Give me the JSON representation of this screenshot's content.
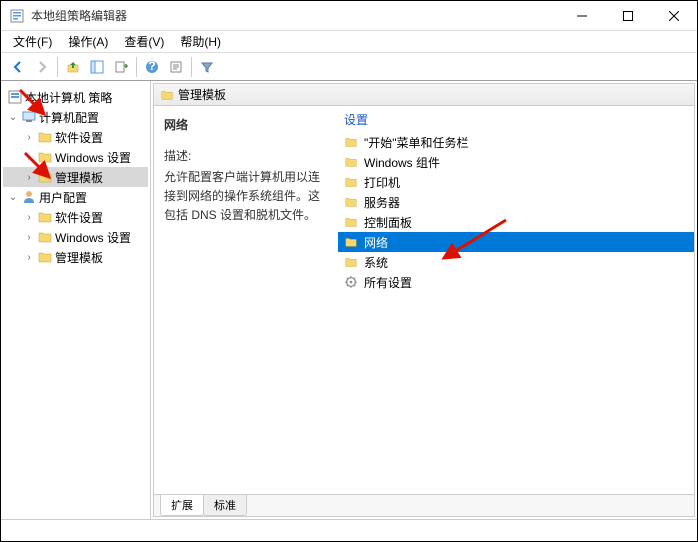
{
  "window": {
    "title": "本地组策略编辑器"
  },
  "menu": {
    "file": "文件(F)",
    "action": "操作(A)",
    "view": "查看(V)",
    "help": "帮助(H)"
  },
  "tree": {
    "root": "本地计算机 策略",
    "computer_config": "计算机配置",
    "software_settings": "软件设置",
    "windows_settings": "Windows 设置",
    "admin_templates": "管理模板",
    "user_config": "用户配置"
  },
  "right": {
    "header": "管理模板",
    "leftTitle": "网络",
    "descLabel": "描述:",
    "descText": "允许配置客户端计算机用以连接到网络的操作系统组件。这包括 DNS 设置和脱机文件。",
    "settingsLabel": "设置",
    "items": [
      "\"开始\"菜单和任务栏",
      "Windows 组件",
      "打印机",
      "服务器",
      "控制面板",
      "网络",
      "系统",
      "所有设置"
    ],
    "selectedIndex": 5
  },
  "tabs": {
    "extended": "扩展",
    "standard": "标准"
  }
}
